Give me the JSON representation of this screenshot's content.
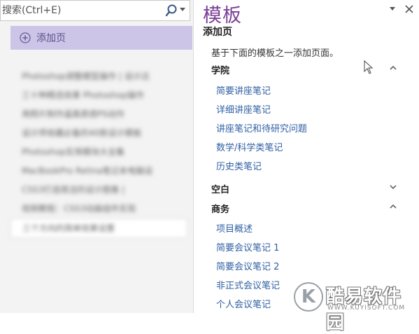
{
  "search": {
    "placeholder": "搜索(Ctrl+E)"
  },
  "left": {
    "add_page_label": "添加页",
    "pages": [
      "Photoshop调整模型操作 | 设计达",
      "三十种精选效果 Photoshop操作",
      "用照片制作逼真质感PS动作",
      "设计师收藏必备的40款设计模板",
      "Photoshop实用模块大全集",
      "MacBookPro Retina笔记本电脑设",
      "CSS3打造简洁的设计图像 |",
      "视频教程：CSS3动画组件实现",
      "三个方向的简单效果设置"
    ]
  },
  "right": {
    "title": "模板",
    "subtitle": "添加页",
    "description": "基于下面的模板之一添加页面。",
    "sections": [
      {
        "name": "学院",
        "state": "expanded",
        "items": [
          "简要讲座笔记",
          "详细讲座笔记",
          "讲座笔记和待研究问题",
          "数学/科学类笔记",
          "历史类笔记"
        ]
      },
      {
        "name": "空白",
        "state": "collapsed",
        "items": []
      },
      {
        "name": "商务",
        "state": "expanded",
        "items": [
          "项目概述",
          "简要会议笔记 1",
          "简要会议笔记 2",
          "非正式会议笔记",
          "个人会议笔记"
        ]
      }
    ]
  },
  "watermark": {
    "cn": "酷易软件园",
    "en": "WWW.KUYISOFT.COM",
    "badge": "K"
  },
  "colors": {
    "accent": "#7a3f96",
    "link": "#2f5fa3",
    "add_page_bg": "#cdc5e7"
  }
}
